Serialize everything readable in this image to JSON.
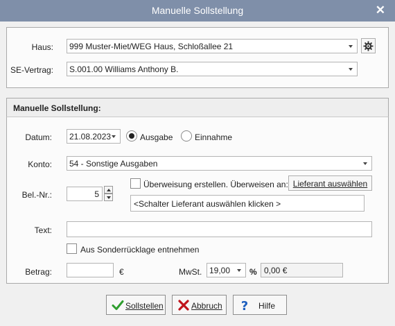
{
  "window": {
    "title": "Manuelle Sollstellung",
    "close_glyph": "✕"
  },
  "top": {
    "haus_label": "Haus:",
    "haus_value": "999 Muster-Miet/WEG Haus, Schloßallee 21",
    "se_label": "SE-Vertrag:",
    "se_value": "S.001.00 Williams Anthony B."
  },
  "section": {
    "title": "Manuelle Sollstellung:",
    "datum_label": "Datum:",
    "datum_value": "21.08.2023",
    "ausgabe_label": "Ausgabe",
    "einnahme_label": "Einnahme",
    "konto_label": "Konto:",
    "konto_value": "54 - Sonstige Ausgaben",
    "belnr_label": "Bel.-Nr.:",
    "belnr_value": "5",
    "ueberweisung_label": "Überweisung erstellen. Überweisen an:",
    "lieferant_button": "Lieferant auswählen",
    "lieferant_hint": "<Schalter Lieferant auswählen klicken >",
    "text_label": "Text:",
    "text_value": "",
    "sonder_label": "Aus Sonderrücklage entnehmen",
    "betrag_label": "Betrag:",
    "betrag_value": "",
    "currency": "€",
    "mwst_label": "MwSt.",
    "mwst_value": "19,00",
    "percent": "%",
    "mwst_amount": "0,00 €"
  },
  "footer": {
    "sollstellen": "Sollstellen",
    "abbruch": "Abbruch",
    "hilfe": "Hilfe"
  },
  "colors": {
    "titlebar": "#7f8fa9",
    "check_green": "#2e9e2e",
    "cross_red": "#c0141c",
    "help_blue": "#1d5fbf"
  }
}
